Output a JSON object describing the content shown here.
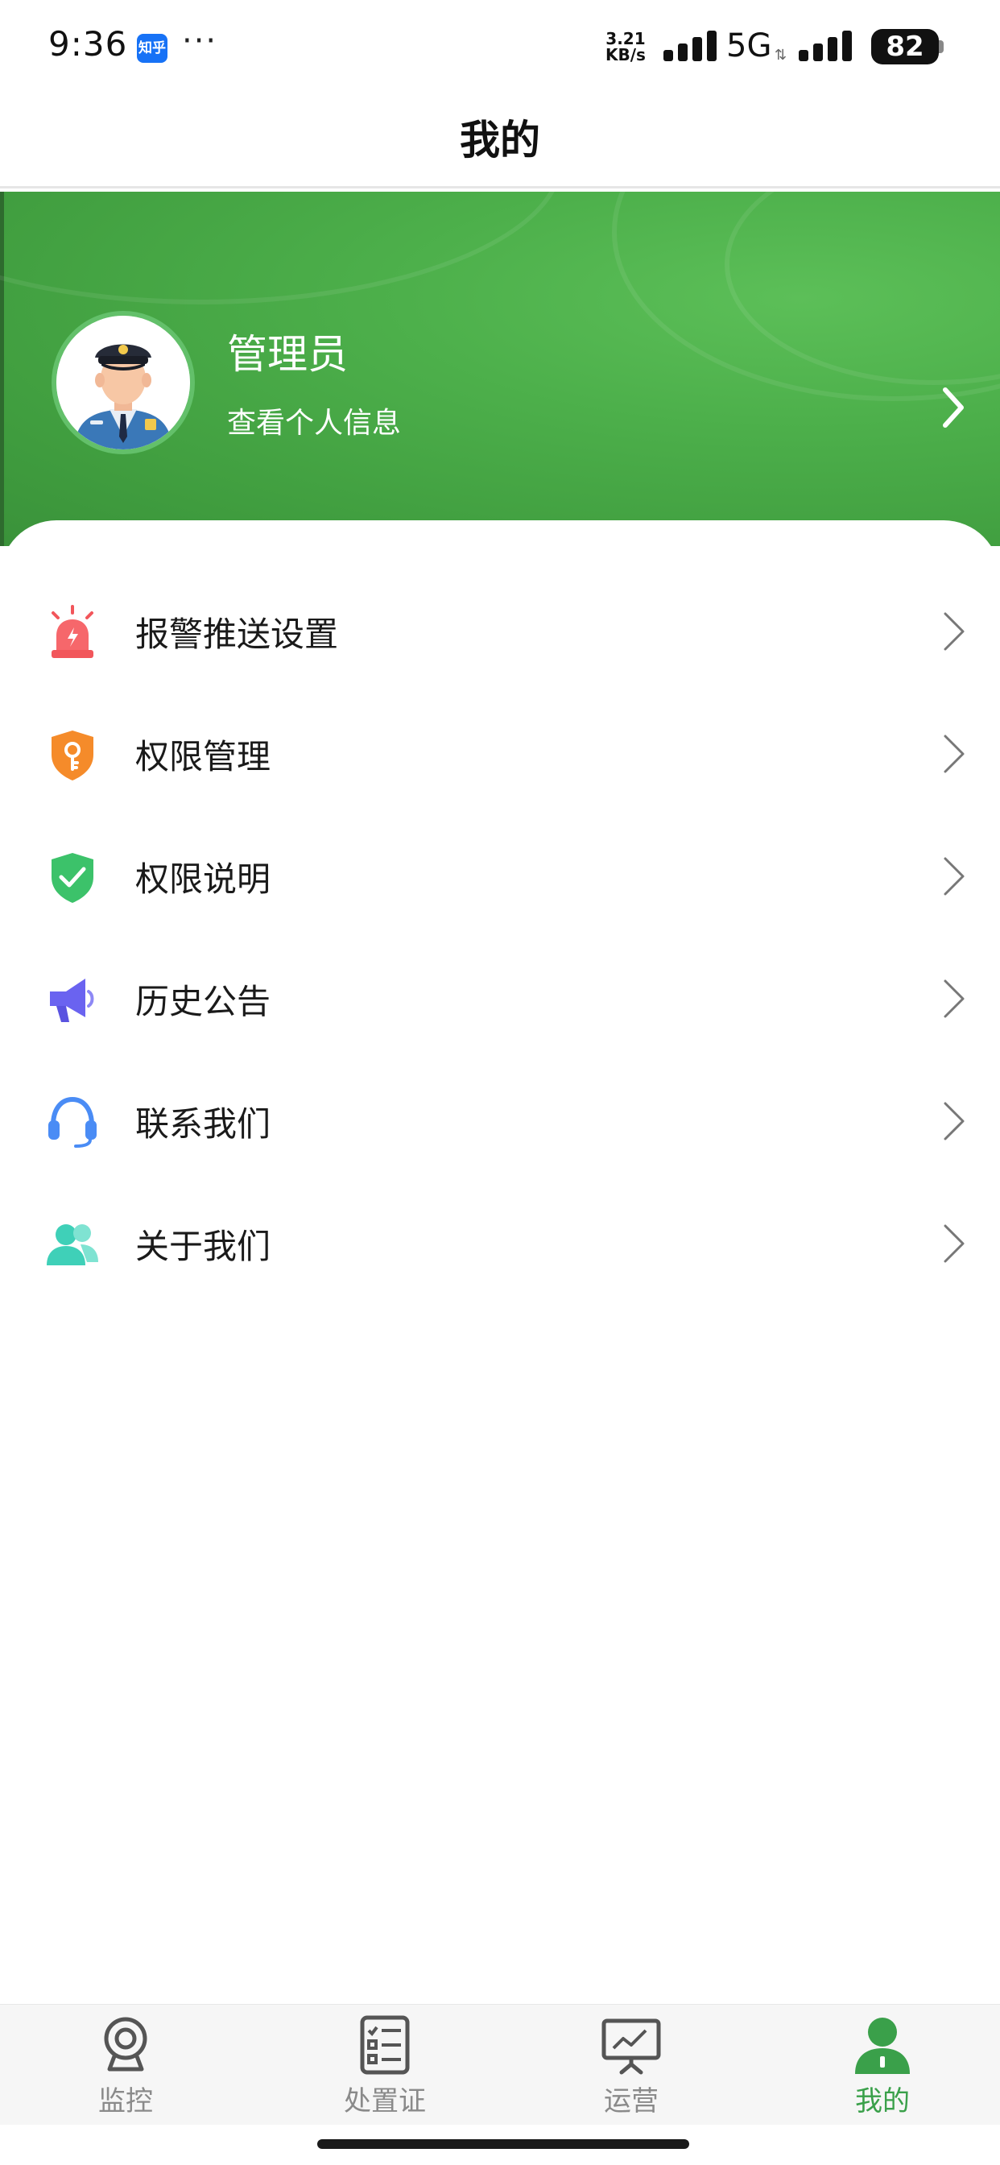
{
  "status_bar": {
    "time": "9:36",
    "app_badge": "知乎",
    "more": "···",
    "speed_value": "3.21",
    "speed_unit": "KB/s",
    "network": "5G",
    "battery": "82"
  },
  "header": {
    "title": "我的"
  },
  "profile": {
    "name": "管理员",
    "subtitle": "查看个人信息",
    "colors": {
      "green": "#4db04b"
    }
  },
  "menu": {
    "items": [
      {
        "label": "报警推送设置",
        "icon": "alarm-icon",
        "color": "#f2565b"
      },
      {
        "label": "权限管理",
        "icon": "key-shield-icon",
        "color": "#f58b2a"
      },
      {
        "label": "权限说明",
        "icon": "check-shield-icon",
        "color": "#3cc26a"
      },
      {
        "label": "历史公告",
        "icon": "megaphone-icon",
        "color": "#6a63f0"
      },
      {
        "label": "联系我们",
        "icon": "headset-icon",
        "color": "#4a8cf5"
      },
      {
        "label": "关于我们",
        "icon": "users-icon",
        "color": "#3fd0b8"
      }
    ]
  },
  "bottom_nav": {
    "items": [
      {
        "label": "监控",
        "icon": "camera-icon",
        "active": false
      },
      {
        "label": "处置证",
        "icon": "checklist-icon",
        "active": false
      },
      {
        "label": "运营",
        "icon": "chart-board-icon",
        "active": false
      },
      {
        "label": "我的",
        "icon": "person-icon",
        "active": true
      }
    ],
    "active_color": "#3aa04a",
    "inactive_color": "#8a8a8a"
  }
}
